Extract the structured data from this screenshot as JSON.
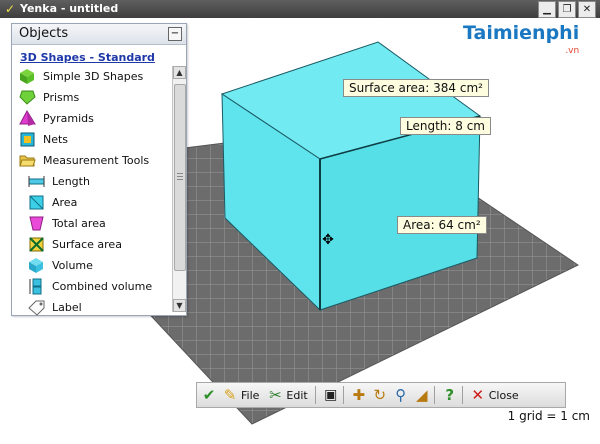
{
  "window": {
    "title": "Yenka - untitled"
  },
  "watermark": {
    "brand": "Taimienphi",
    "tld": ".vn"
  },
  "panel": {
    "title": "Objects",
    "category": "3D Shapes - Standard",
    "items": [
      {
        "label": "Simple 3D Shapes",
        "icon": "cube-green-icon",
        "indent": false
      },
      {
        "label": "Prisms",
        "icon": "prism-green-icon",
        "indent": false
      },
      {
        "label": "Pyramids",
        "icon": "pyramid-magenta-icon",
        "indent": false
      },
      {
        "label": "Nets",
        "icon": "net-cyan-icon",
        "indent": false
      },
      {
        "label": "Measurement Tools",
        "icon": "folder-open-icon",
        "indent": false
      },
      {
        "label": "Length",
        "icon": "ruler-length-icon",
        "indent": true
      },
      {
        "label": "Area",
        "icon": "area-square-icon",
        "indent": true
      },
      {
        "label": "Total area",
        "icon": "total-area-icon",
        "indent": true
      },
      {
        "label": "Surface area",
        "icon": "surface-area-icon",
        "indent": true
      },
      {
        "label": "Volume",
        "icon": "volume-cube-icon",
        "indent": true
      },
      {
        "label": "Combined volume",
        "icon": "combined-volume-icon",
        "indent": true
      },
      {
        "label": "Label",
        "icon": "label-tag-icon",
        "indent": true
      }
    ]
  },
  "callouts": {
    "surface_area": "Surface area: 384 cm²",
    "length": "Length: 8 cm",
    "area": "Area: 64 cm²"
  },
  "toolbar": {
    "file_label": "File",
    "edit_label": "Edit",
    "close_label": "Close"
  },
  "status": {
    "scale": "1 grid = 1 cm"
  },
  "colors": {
    "cube": "#62e6ee",
    "grid": "#6a6a6a",
    "callout_bg": "#fffde0"
  }
}
